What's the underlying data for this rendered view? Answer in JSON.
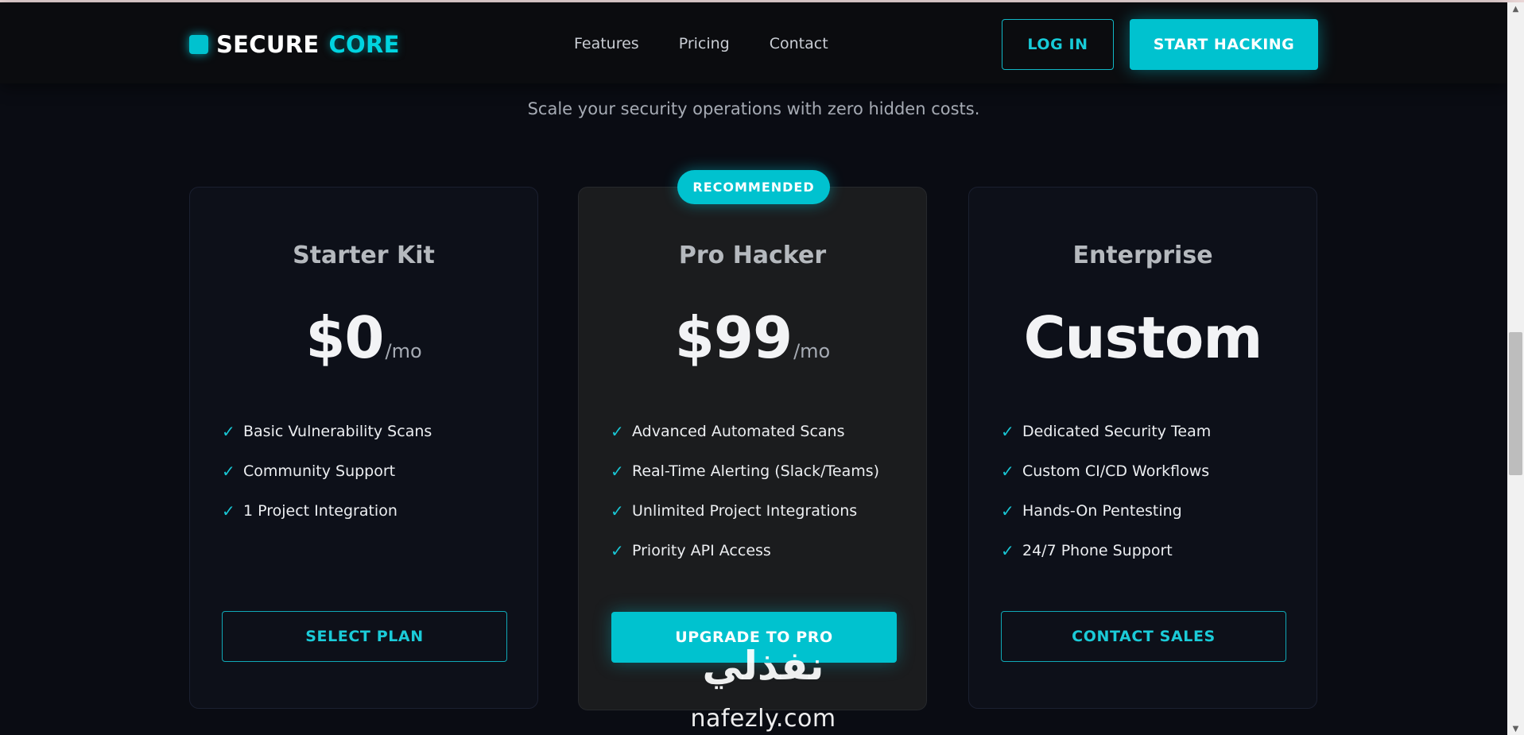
{
  "brand": {
    "name_part1": "SECURE",
    "name_part2": "CORE",
    "accent_color": "#00c2cf"
  },
  "nav": {
    "items": [
      {
        "label": "Features"
      },
      {
        "label": "Pricing"
      },
      {
        "label": "Contact"
      }
    ]
  },
  "header_actions": {
    "login_label": "LOG IN",
    "start_label": "START HACKING"
  },
  "pricing": {
    "subtitle": "Scale your security operations with zero hidden costs.",
    "badge": "RECOMMENDED",
    "plans": [
      {
        "title": "Starter Kit",
        "price": "$0",
        "period": "/mo",
        "features": [
          "Basic Vulnerability Scans",
          "Community Support",
          "1 Project Integration"
        ],
        "cta": "SELECT PLAN"
      },
      {
        "title": "Pro Hacker",
        "price": "$99",
        "period": "/mo",
        "features": [
          "Advanced Automated Scans",
          "Real-Time Alerting (Slack/Teams)",
          "Unlimited Project Integrations",
          "Priority API Access"
        ],
        "cta": "UPGRADE TO PRO"
      },
      {
        "title": "Enterprise",
        "price": "Custom",
        "features": [
          "Dedicated Security Team",
          "Custom CI/CD Workflows",
          "Hands-On Pentesting",
          "24/7 Phone Support"
        ],
        "cta": "CONTACT SALES"
      }
    ],
    "check_glyph": "✓"
  },
  "watermark": {
    "arabic": "نفذلي",
    "latin": "nafezly.com"
  }
}
